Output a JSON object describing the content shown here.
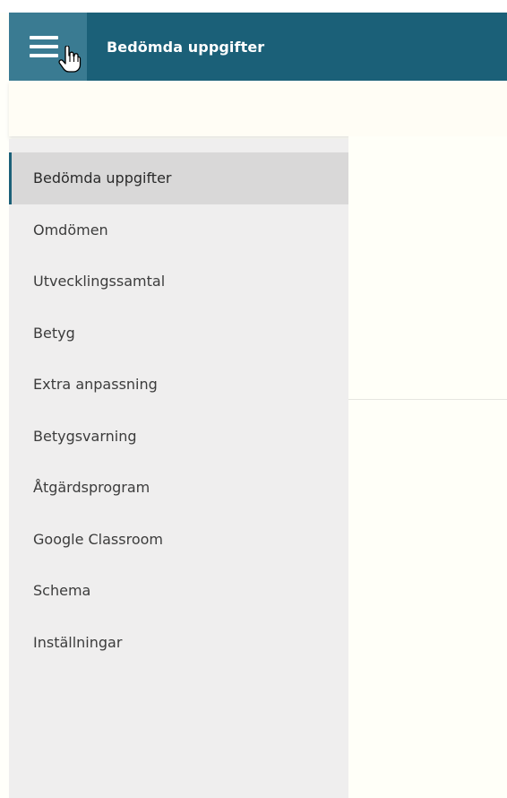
{
  "header": {
    "title": "Bedömda uppgifter",
    "menu_icon": "hamburger-menu-icon",
    "accent_color": "#1b6078"
  },
  "sidebar": {
    "active_index": 0,
    "items": [
      {
        "label": "Bedömda uppgifter"
      },
      {
        "label": "Omdömen"
      },
      {
        "label": "Utvecklingssamtal"
      },
      {
        "label": "Betyg"
      },
      {
        "label": "Extra anpassning"
      },
      {
        "label": "Betygsvarning"
      },
      {
        "label": "Åtgärdsprogram"
      },
      {
        "label": "Google Classroom"
      },
      {
        "label": "Schema"
      },
      {
        "label": "Inställningar"
      }
    ]
  }
}
